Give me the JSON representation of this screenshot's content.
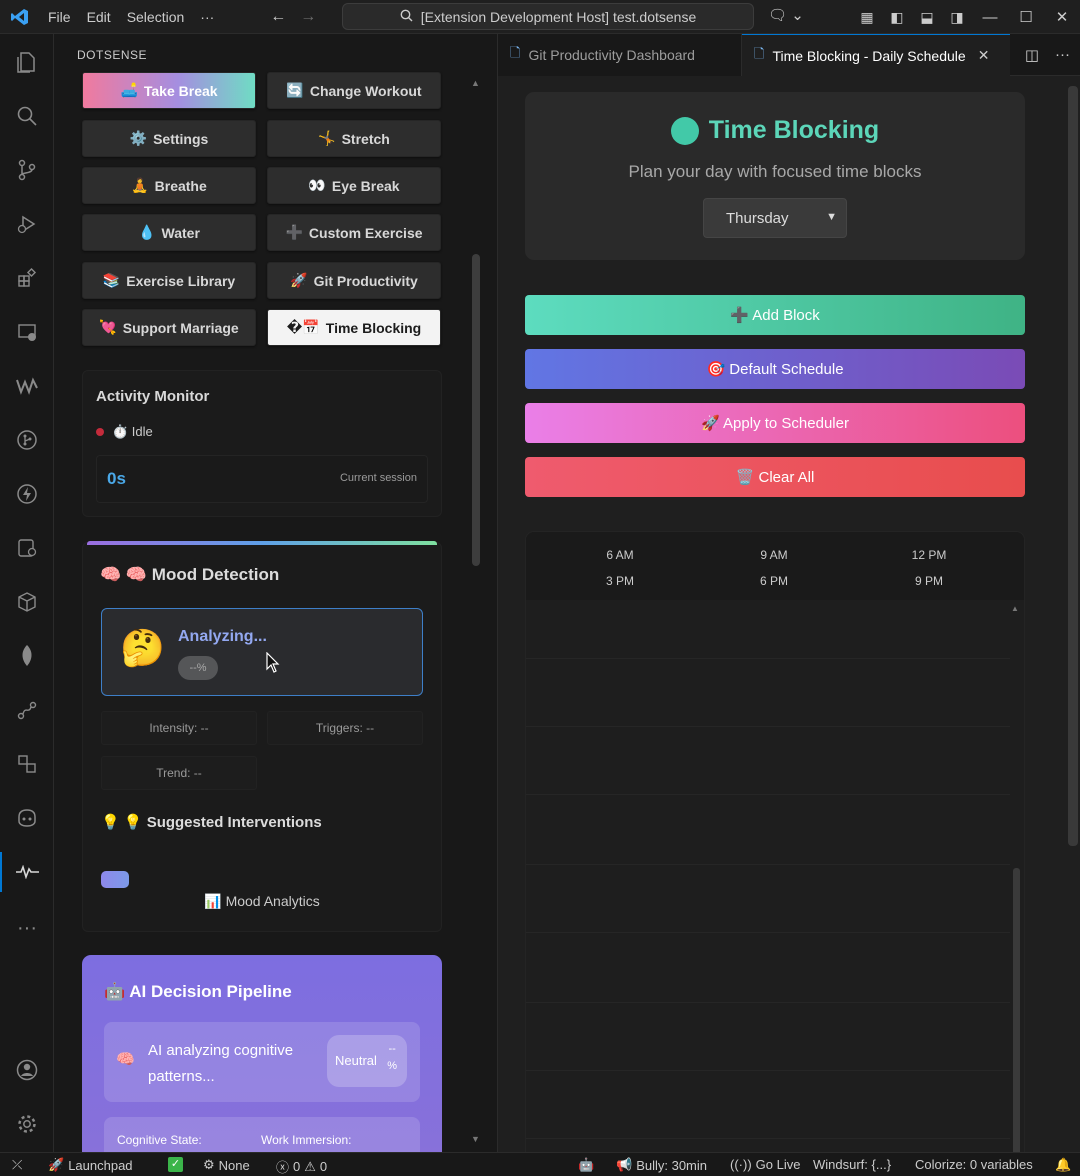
{
  "titlebar": {
    "menus": [
      "File",
      "Edit",
      "Selection",
      "···"
    ],
    "search_text": "[Extension Development Host] test.dotsense"
  },
  "sidebar": {
    "title": "DOTSENSE",
    "buttons": [
      {
        "icon": "🛋️",
        "label": "Take Break"
      },
      {
        "icon": "🔄",
        "label": "Change Workout"
      },
      {
        "icon": "⚙️",
        "label": "Settings"
      },
      {
        "icon": "🤸",
        "label": "Stretch"
      },
      {
        "icon": "🧘",
        "label": "Breathe"
      },
      {
        "icon": "👀",
        "label": "Eye Break"
      },
      {
        "icon": "💧",
        "label": "Water"
      },
      {
        "icon": "➕",
        "label": "Custom Exercise"
      },
      {
        "icon": "📚",
        "label": "Exercise Library"
      },
      {
        "icon": "🚀",
        "label": "Git Productivity"
      },
      {
        "icon": "💘",
        "label": "Support Marriage"
      },
      {
        "icon": "�📅",
        "label": "Time Blocking"
      }
    ],
    "activity": {
      "title": "Activity Monitor",
      "status": "⏱️ Idle",
      "value": "0s",
      "value_label": "Current session"
    },
    "mood": {
      "title": "🧠 🧠 Mood Detection",
      "emoji": "🤔",
      "analyzing": "Analyzing...",
      "pill": "--%",
      "intensity": "Intensity: --",
      "triggers": "Triggers: --",
      "trend": "Trend: --",
      "suggested": "💡 💡 Suggested Interventions",
      "analytics": "📊 Mood Analytics"
    },
    "ai": {
      "title": "🤖 AI Decision Pipeline",
      "icon": "🧠",
      "text": "AI analyzing cognitive patterns...",
      "neutral": "Neutral",
      "neutral_pct_top": "--",
      "neutral_pct_bottom": "%",
      "cognitive_label": "Cognitive State:",
      "work_label": "Work Immersion:"
    }
  },
  "editor": {
    "tabs": [
      {
        "label": "Git Productivity Dashboard",
        "active": false
      },
      {
        "label": "Time Blocking - Daily Schedule",
        "active": true
      }
    ],
    "header": {
      "title": "Time Blocking",
      "subtitle": "Plan your day with focused time blocks",
      "day": "Thursday"
    },
    "actions": {
      "add": "➕ Add Block",
      "default": "🎯 Default Schedule",
      "apply": "🚀 Apply to Scheduler",
      "clear": "🗑️ Clear All"
    },
    "timeline_labels": [
      "6 AM",
      "9 AM",
      "12 PM",
      "3 PM",
      "6 PM",
      "9 PM"
    ]
  },
  "statusbar": {
    "launchpad": "Launchpad",
    "none": "None",
    "errors": "0",
    "warnings": "0",
    "bully": "Bully: 30min",
    "golive": "Go Live",
    "windsurf": "Windsurf: {...}",
    "colorize": "Colorize: 0 variables"
  }
}
